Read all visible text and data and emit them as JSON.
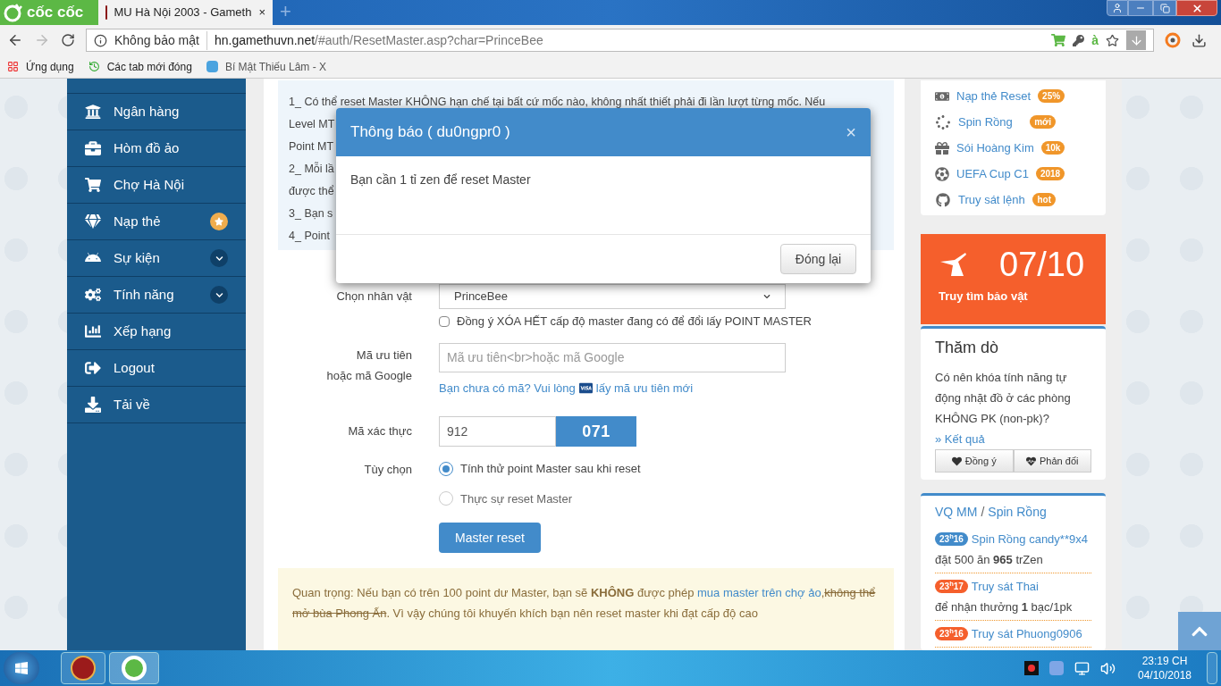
{
  "browser": {
    "brand": "cốc cốc",
    "tab": {
      "title": "MU Hà Nội 2003 - Gameth",
      "close": "×"
    },
    "new_tab": "+",
    "security": "Không bảo mật",
    "url_host": "hn.gamethuvn.net",
    "url_path": "/#auth/ResetMaster.asp?char=PrinceBee",
    "translate_mark": "à",
    "bookmarks": [
      "Ứng dụng",
      "Các tab mới đóng",
      "Bí Mật Thiếu Lâm - X"
    ]
  },
  "sidebar": {
    "items": [
      {
        "label": "Ngân hàng",
        "kind": "plain"
      },
      {
        "label": "Hòm đồ ảo",
        "kind": "plain"
      },
      {
        "label": "Chợ Hà Nội",
        "kind": "plain"
      },
      {
        "label": "Nạp thẻ",
        "kind": "star"
      },
      {
        "label": "Sự kiện",
        "kind": "chevron"
      },
      {
        "label": "Tính năng",
        "kind": "chevron"
      },
      {
        "label": "Xếp hạng",
        "kind": "plain"
      },
      {
        "label": "Logout",
        "kind": "plain"
      },
      {
        "label": "Tải về",
        "kind": "plain"
      }
    ]
  },
  "info_lines": [
    "1_ Có thể reset Master KHÔNG hạn chế tại bất cứ mốc nào, không nhất thiết phải đi lần lượt từng mốc. Nếu",
    "Level MT",
    "Point MT",
    "2_ Mỗi lầ",
    "được thể",
    "3_ Bạn s",
    "4_ Point"
  ],
  "form": {
    "character_label": "Chọn nhân vật",
    "character_value": "PrinceBee",
    "agree": {
      "label": "Đồng ý XÓA HẾT cấp độ master đang có để đổi lấy POINT MASTER",
      "checked": false
    },
    "code_label": [
      "Mã ưu tiên",
      "hoặc mã Google"
    ],
    "code_placeholder": "Mã ưu tiên<br>hoặc mã Google",
    "code_help": "Bạn chưa có mã? Vui lòng",
    "code_link": "lấy mã ưu tiên mới",
    "captcha_label": "Mã xác thực",
    "captcha_value": "912",
    "captcha": "071",
    "options_label": "Tùy chọn",
    "options": [
      {
        "label": "Tính thử point Master sau khi reset",
        "selected": true
      },
      {
        "label": "Thực sự reset Master",
        "selected": false
      }
    ],
    "submit": "Master reset"
  },
  "notice": [
    {
      "kind": "text",
      "text": "Quan trọng: Nếu bạn có trên 100 point dư Master, bạn sẽ "
    },
    {
      "kind": "bold",
      "text": "KHÔNG"
    },
    {
      "kind": "text",
      "text": " được phép "
    },
    {
      "kind": "link",
      "text": "mua master trên chợ ảo"
    },
    {
      "kind": "text",
      "text": ","
    },
    {
      "kind": "strike",
      "text": "không thể mở bùa Phong Ấn"
    },
    {
      "kind": "text",
      "text": ". Vì vậy chúng tôi khuyến khích bạn nên reset master khi đạt cấp độ cao"
    }
  ],
  "modal": {
    "title": "Thông báo ( du0ngpr0 )",
    "close": "×",
    "message": "Bạn cần 1 tỉ zen để reset Master",
    "button": "Đóng lại"
  },
  "features": [
    {
      "label": "Nạp thẻ Reset",
      "badge": "25%"
    },
    {
      "label": "Spin Rồng",
      "badge": "mới"
    },
    {
      "label": "Sói Hoàng Kim",
      "badge": "10k"
    },
    {
      "label": "UEFA Cup C1",
      "badge": "2018"
    },
    {
      "label": "Truy sát lệnh",
      "badge": "hot"
    }
  ],
  "treasure": {
    "count": "07/10",
    "label": "Truy tìm bảo vật"
  },
  "poll": {
    "title": "Thăm dò",
    "question": "Có nên khóa tính năng tự động nhặt đồ ở các phòng KHÔNG PK (non-pk)?",
    "result_link": "» Kết quả",
    "buttons": [
      "Đồng ý",
      "Phản đối"
    ]
  },
  "feed": {
    "title_link": "VQ MM",
    "separator": "/",
    "title_link_2": "Spin Rồng",
    "entries": [
      {
        "time": "23$^{h}$16",
        "color": "#428bca",
        "link": "Spin Rồng candy**9x4",
        "text": "đặt 500 ăn **965** trZen"
      },
      {
        "time": "23$^{h}$17",
        "color": "#f55f2c",
        "link": "Truy sát Thai",
        "text": "để nhận thưởng **1** bạc/1pk"
      },
      {
        "time": "23$^{h}$16",
        "color": "#f55f2c",
        "link": "Truy sát Phuong0906"
      }
    ]
  },
  "taskbar": {
    "time": "23:19 CH",
    "date": "04/10/2018"
  }
}
